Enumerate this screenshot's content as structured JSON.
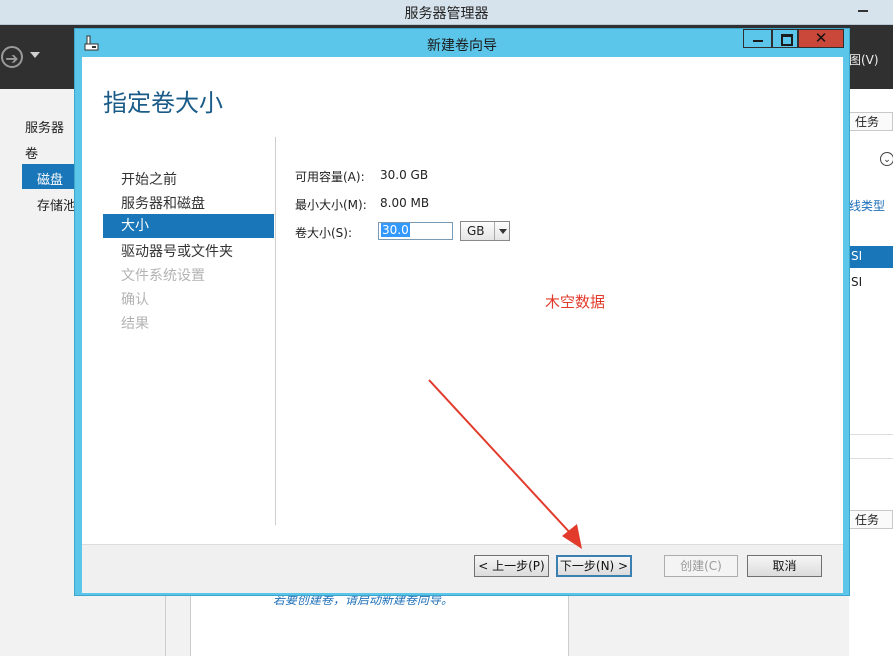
{
  "app": {
    "title": "服务器管理器",
    "view_menu": "图(V)",
    "nav": {
      "servers": "服务器",
      "volumes": "卷",
      "disks": "磁盘",
      "storage_pools": "存储池"
    },
    "right_panel": {
      "tasks_top": "任务",
      "column_type": "线类型",
      "row1": "SI",
      "row2": "SI",
      "tasks_bottom": "任务"
    },
    "bottom_hint": "若要创建卷，请启动新建卷向导。"
  },
  "dialog": {
    "title": "新建卷向导",
    "heading": "指定卷大小",
    "steps": [
      {
        "label": "开始之前",
        "state": "done"
      },
      {
        "label": "服务器和磁盘",
        "state": "done"
      },
      {
        "label": "大小",
        "state": "selected"
      },
      {
        "label": "驱动器号或文件夹",
        "state": "done"
      },
      {
        "label": "文件系统设置",
        "state": "disabled"
      },
      {
        "label": "确认",
        "state": "disabled"
      },
      {
        "label": "结果",
        "state": "disabled"
      }
    ],
    "fields": {
      "available_label": "可用容量(A):",
      "available_value": "30.0 GB",
      "min_label": "最小大小(M):",
      "min_value": "8.00 MB",
      "size_label": "卷大小(S):",
      "size_value": "30.0",
      "unit_value": "GB"
    },
    "watermark": "木空数据",
    "buttons": {
      "prev": "< 上一步(P)",
      "next": "下一步(N) >",
      "create": "创建(C)",
      "cancel": "取消"
    }
  },
  "colors": {
    "dialog_frame": "#5bc6ea",
    "selection": "#1976b8",
    "heading": "#1a5b88",
    "annotation_red": "#e23b2c"
  },
  "icons": [
    "back-arrow-icon",
    "dropdown-icon",
    "wizard-icon",
    "minimize-icon",
    "maximize-icon",
    "close-icon",
    "chevron-icon",
    "select-arrow-icon"
  ]
}
